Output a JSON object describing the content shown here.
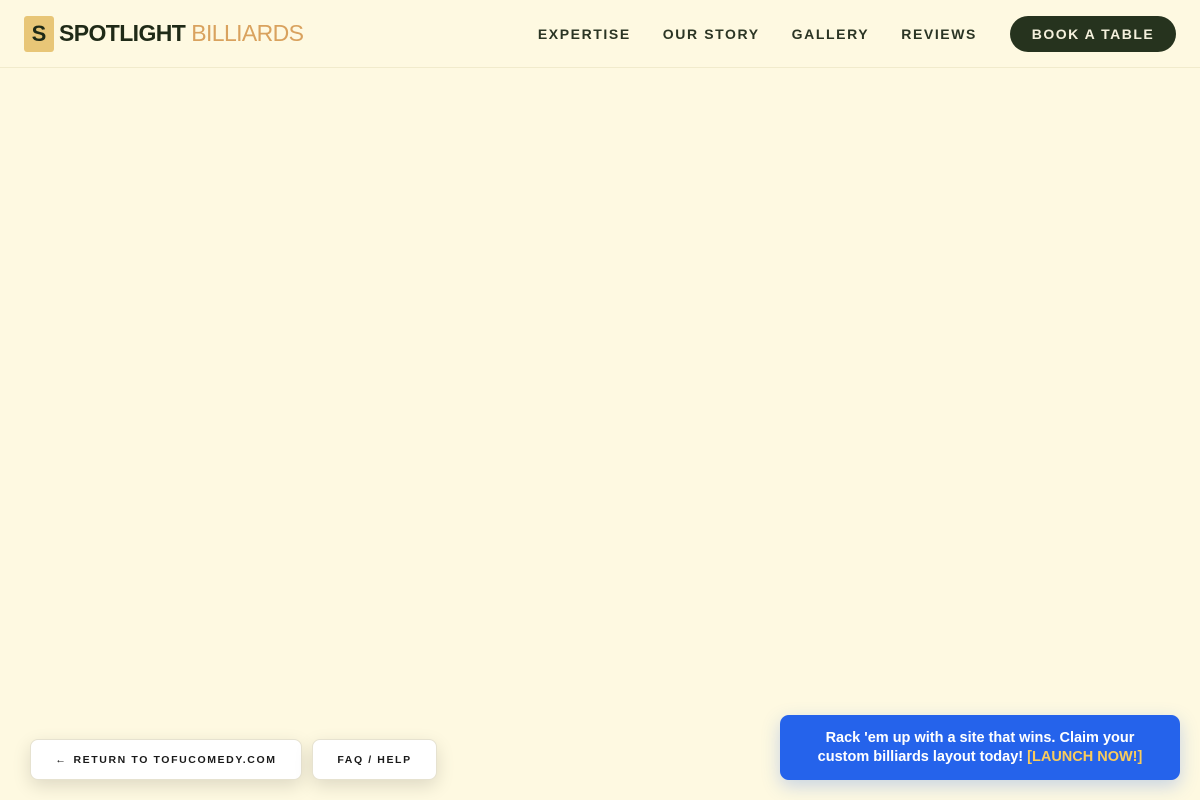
{
  "brand": {
    "mark": "S",
    "name_strong": "SPOTLIGHT",
    "name_light": "BILLIARDS"
  },
  "nav": {
    "items": [
      {
        "label": "EXPERTISE"
      },
      {
        "label": "OUR STORY"
      },
      {
        "label": "GALLERY"
      },
      {
        "label": "REVIEWS"
      }
    ],
    "cta_label": "BOOK A TABLE"
  },
  "floating": {
    "return_arrow": "←",
    "return_label": "RETURN TO TOFUCOMEDY.COM",
    "faq_label": "FAQ / HELP"
  },
  "promo": {
    "text": "Rack 'em up with a site that wins. Claim your custom billiards layout today!",
    "link_label": "[LAUNCH NOW!]"
  },
  "colors": {
    "background": "#fef9e1",
    "brand_mark": "#e8c677",
    "brand_light": "#d9a25e",
    "cta_bg": "#26331e",
    "promo_bg": "#2563eb",
    "promo_link": "#facc5b"
  }
}
